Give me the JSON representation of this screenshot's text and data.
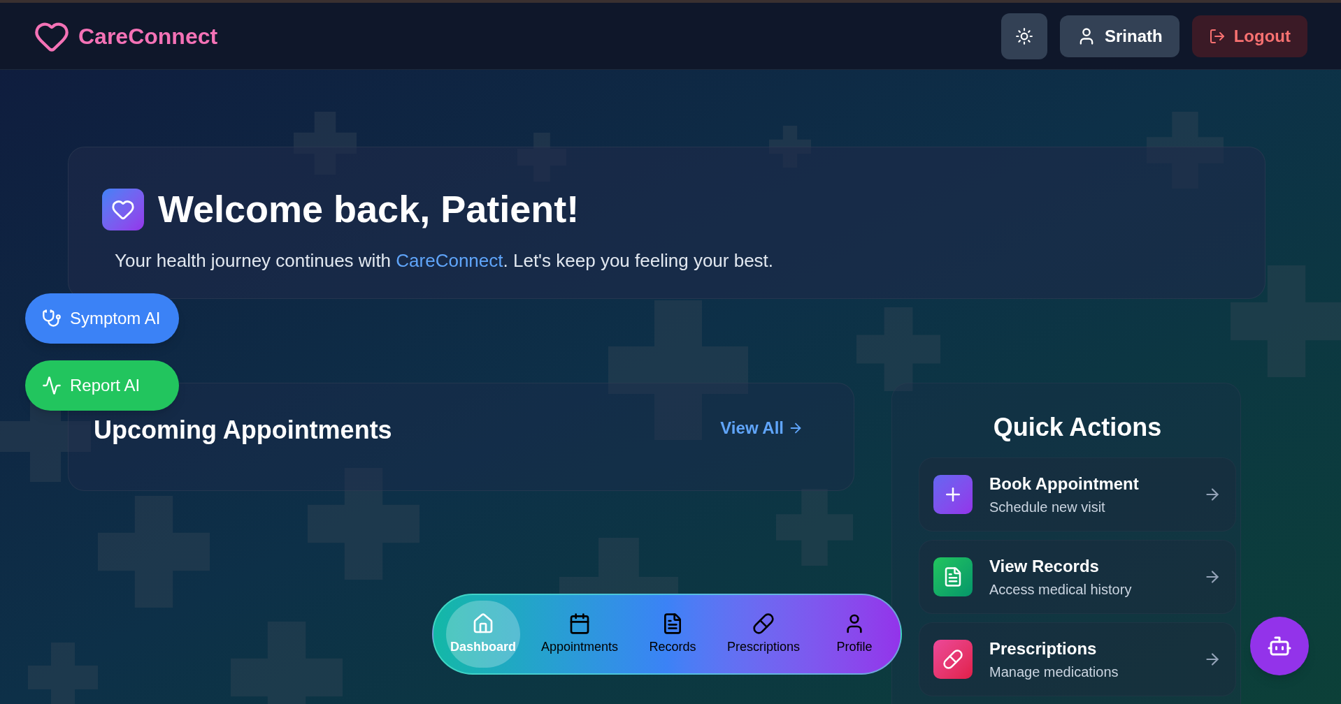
{
  "header": {
    "brand": "CareConnect",
    "user": "Srinath",
    "logout": "Logout"
  },
  "welcome": {
    "title": "Welcome back, Patient!",
    "subtitle": "Your health journey continues with **CareConnect**. Let's keep you feeling your best."
  },
  "floating_buttons": [
    {
      "kind": "symptom",
      "label": "Symptom AI"
    },
    {
      "kind": "report",
      "label": "Report AI"
    }
  ],
  "appointments": {
    "title": "Upcoming Appointments",
    "link": "View All"
  },
  "quick_actions": {
    "title": "Quick Actions",
    "items": [
      {
        "kind": "book",
        "title": "Book Appointment",
        "subtitle": "Schedule new visit"
      },
      {
        "kind": "records",
        "title": "View Records",
        "subtitle": "Access medical history"
      },
      {
        "kind": "prescriptions",
        "title": "Prescriptions",
        "subtitle": "Manage medications"
      }
    ]
  },
  "bottom_nav": [
    {
      "kind": "home",
      "label": "Dashboard",
      "selected": true
    },
    {
      "kind": "calendar",
      "label": "Appointments",
      "selected": false
    },
    {
      "kind": "file",
      "label": "Records",
      "selected": false
    },
    {
      "kind": "pill",
      "label": "Prescriptions",
      "selected": false
    },
    {
      "kind": "user",
      "label": "Profile",
      "selected": false
    }
  ]
}
